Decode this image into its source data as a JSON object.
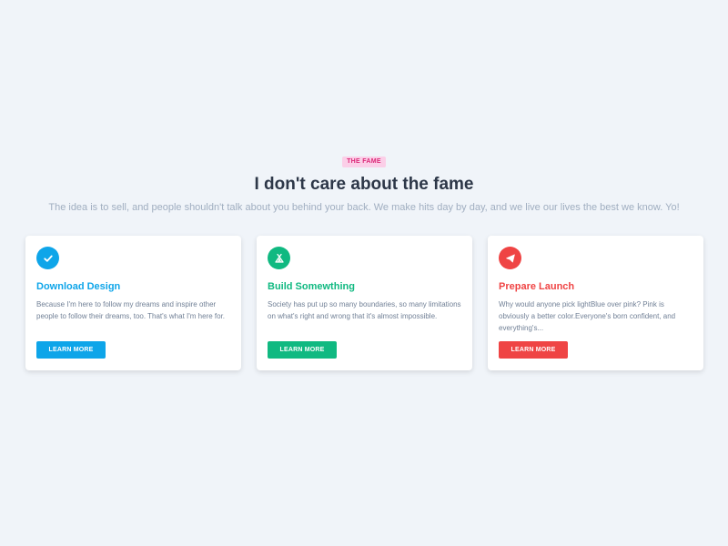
{
  "header": {
    "badge": "THE FAME",
    "title": "I don't care about the fame",
    "subtitle": "The idea is to sell, and people shouldn't talk about you behind your back. We make hits day by day, and we live our lives the best we know. Yo!"
  },
  "colors": {
    "badge_bg": "#fbcfe8",
    "badge_text": "#db2777",
    "blue": "#0ea5e9",
    "green": "#10b981",
    "red": "#ef4444"
  },
  "cards": [
    {
      "icon": "check-icon",
      "title": "Download Design",
      "text": "Because I'm here to follow my dreams and inspire other people to follow their dreams, too. That's what I'm here for.",
      "button": "LEARN MORE",
      "color": "#0ea5e9"
    },
    {
      "icon": "campground-icon",
      "title": "Build Somewthing",
      "text": "Society has put up so many boundaries, so many limitations on what's right and wrong that it's almost impossible.",
      "button": "LEARN MORE",
      "color": "#10b981"
    },
    {
      "icon": "paper-plane-icon",
      "title": "Prepare Launch",
      "text": "Why would anyone pick lightBlue over pink? Pink is obviously a better color.Everyone's born confident, and everything's...",
      "button": "LEARN MORE",
      "color": "#ef4444"
    }
  ]
}
